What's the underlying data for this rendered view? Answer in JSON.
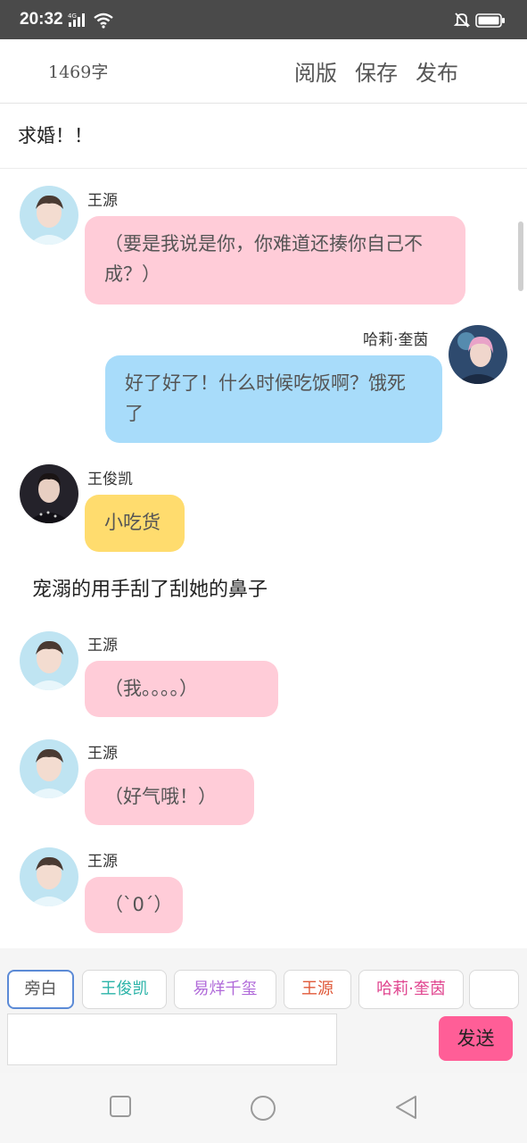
{
  "status_bar": {
    "time": "20:32",
    "network": "4G"
  },
  "toolbar": {
    "word_count": "1469字",
    "preview_label": "阅版",
    "save_label": "保存",
    "publish_label": "发布"
  },
  "story": {
    "title": "求婚！！"
  },
  "messages": [
    {
      "sender": "王源",
      "text": "（要是我说是你，你难道还揍你自己不成？）",
      "color": "#ffccd8"
    },
    {
      "sender": "哈莉·奎茵",
      "text": "好了好了！什么时候吃饭啊？饿死了",
      "color": "#a8dcfa"
    },
    {
      "sender": "王俊凯",
      "text": "小吃货",
      "color": "#ffdc6e"
    },
    {
      "narration": "宠溺的用手刮了刮她的鼻子"
    },
    {
      "sender": "王源",
      "text": "（我。。。。）",
      "color": "#ffccd8"
    },
    {
      "sender": "王源",
      "text": "（好气哦！）",
      "color": "#ffccd8"
    },
    {
      "sender": "王源",
      "text": "（`0´）",
      "color": "#ffccd8"
    }
  ],
  "composer": {
    "characters": [
      {
        "label": "旁白",
        "color": "#555555"
      },
      {
        "label": "王俊凯",
        "color": "#2bb3a8"
      },
      {
        "label": "易烊千玺",
        "color": "#b06ad9"
      },
      {
        "label": "王源",
        "color": "#e05a3a"
      },
      {
        "label": "哈莉·奎茵",
        "color": "#e0458f"
      },
      {
        "label": ""
      }
    ],
    "input_value": "",
    "send_label": "发送"
  },
  "icons": {
    "status": [
      "signal-icon",
      "wifi-icon",
      "mute-bell-icon",
      "battery-icon"
    ],
    "nav": [
      "square-recent-icon",
      "circle-home-icon",
      "triangle-back-icon"
    ]
  }
}
